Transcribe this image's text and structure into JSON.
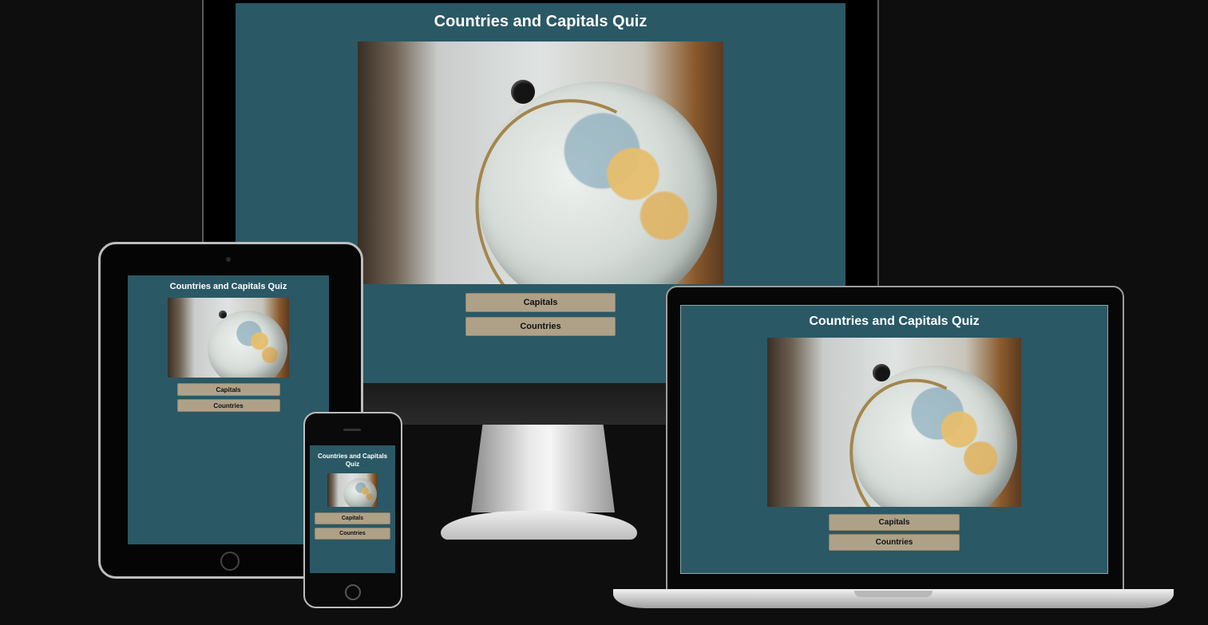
{
  "app": {
    "title": "Countries and Capitals Quiz"
  },
  "buttons": {
    "capitals": "Capitals",
    "countries": "Countries"
  },
  "hero": {
    "image_alt": "globe-photo"
  },
  "colors": {
    "page_bg": "#0f0e0f",
    "screen_bg": "#2a5865",
    "button_bg": "#aea188",
    "title_text": "#ffffff"
  }
}
